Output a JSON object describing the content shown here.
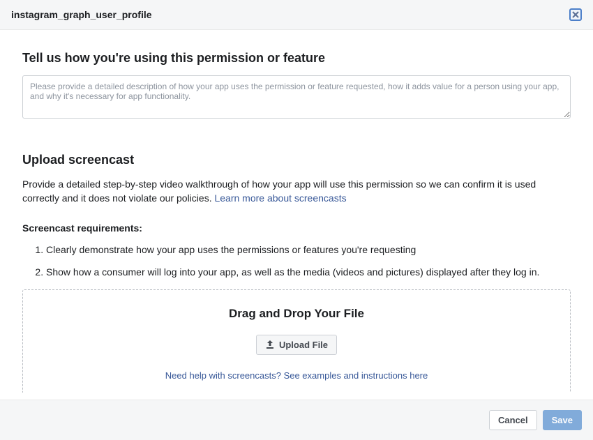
{
  "header": {
    "title": "instagram_graph_user_profile"
  },
  "section1": {
    "heading": "Tell us how you're using this permission or feature",
    "placeholder": "Please provide a detailed description of how your app uses the permission or feature requested, how it adds value for a person using your app, and why it's necessary for app functionality."
  },
  "section2": {
    "heading": "Upload screencast",
    "description_prefix": "Provide a detailed step-by-step video walkthrough of how your app will use this permission so we can confirm it is used correctly and it does not violate our policies. ",
    "learn_more": "Learn more about screencasts",
    "req_heading": "Screencast requirements:",
    "requirements": [
      "Clearly demonstrate how your app uses the permissions or features you're requesting",
      "Show how a consumer will log into your app, as well as the media (videos and pictures) displayed after they log in."
    ],
    "drop_title": "Drag and Drop Your File",
    "upload_label": "Upload File",
    "help_link": "Need help with screencasts? See examples and instructions here"
  },
  "footer": {
    "cancel": "Cancel",
    "save": "Save"
  }
}
